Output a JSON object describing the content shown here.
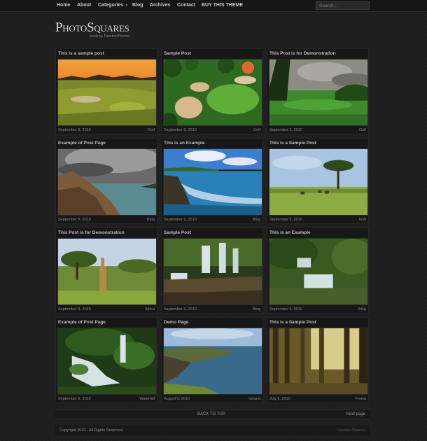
{
  "nav": {
    "items": [
      "Home",
      "About",
      "Categories",
      "Blog",
      "Archives",
      "Contact",
      "BUY THIS THEME"
    ],
    "search_placeholder": "Search..."
  },
  "logo": {
    "text": "PhotoSquares",
    "tagline": "made by FunctionThemes"
  },
  "posts": [
    {
      "title": "This is a sample post",
      "date": "September 9, 2010",
      "category": "Golf"
    },
    {
      "title": "Sample Post",
      "date": "September 9, 2010",
      "category": "Golf"
    },
    {
      "title": "This Post is for Demonstration",
      "date": "September 9, 2010",
      "category": "Golf"
    },
    {
      "title": "Example of Post Page",
      "date": "September 9, 2010",
      "category": "Blog"
    },
    {
      "title": "This is an Example",
      "date": "September 9, 2010",
      "category": "Blog"
    },
    {
      "title": "This is a Sample Post",
      "date": "September 9, 2010",
      "category": "Golf"
    },
    {
      "title": "This Post is for Demonstration",
      "date": "September 9, 2010",
      "category": "Africa"
    },
    {
      "title": "Sample Post",
      "date": "September 9, 2010",
      "category": "Blog"
    },
    {
      "title": "This is an Example",
      "date": "September 9, 2010",
      "category": "Blog"
    },
    {
      "title": "Example of Post Page",
      "date": "September 9, 2010",
      "category": "Waterfall"
    },
    {
      "title": "Demo Page",
      "date": "August 9, 2010",
      "category": "Ireland"
    },
    {
      "title": "This is a Sample Post",
      "date": "July 9, 2010",
      "category": "Forest"
    }
  ],
  "pager": {
    "back_to_top": "BACK TO TOP",
    "next_page": "Next page"
  },
  "footer": {
    "copyright": "Copyright 2010 - All Rights Reserved",
    "credit": "FunctionThemes"
  }
}
